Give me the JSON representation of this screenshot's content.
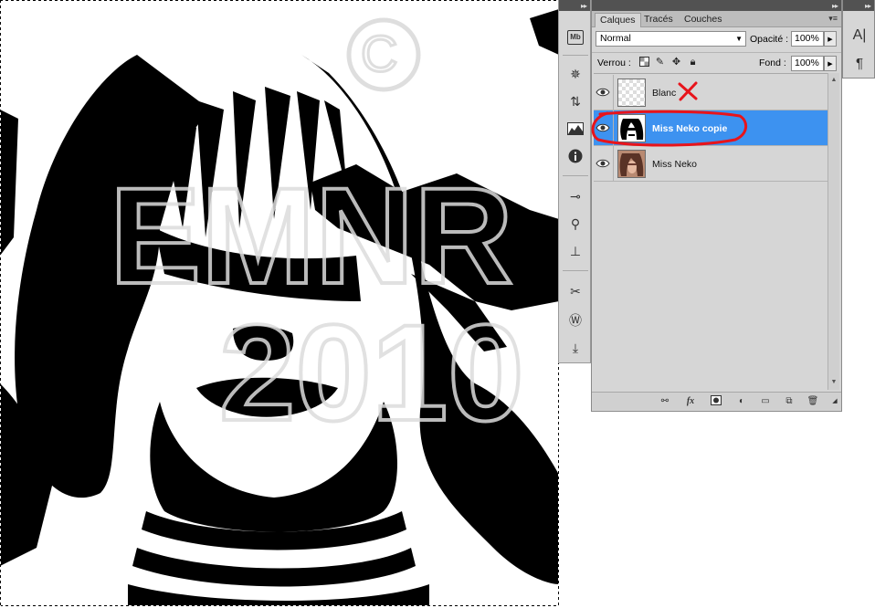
{
  "panel": {
    "tabs": [
      {
        "label": "Calques",
        "active": true
      },
      {
        "label": "Tracés",
        "active": false
      },
      {
        "label": "Couches",
        "active": false
      }
    ],
    "blend_mode": "Normal",
    "opacity_label": "Opacité :",
    "opacity_value": "100%",
    "lock_label": "Verrou :",
    "fill_label": "Fond :",
    "fill_value": "100%"
  },
  "layers": [
    {
      "name": "Blanc",
      "visible": true,
      "selected": false,
      "thumbnail": "transparent-checker"
    },
    {
      "name": "Miss Neko copie",
      "visible": true,
      "selected": true,
      "thumbnail": "bw-portrait"
    },
    {
      "name": "Miss Neko",
      "visible": true,
      "selected": false,
      "thumbnail": "color-portrait"
    }
  ],
  "dock_icons": [
    "mini-bridge-icon",
    "navigator-icon",
    "history-icon",
    "histogram-icon",
    "info-icon",
    "brush-presets-icon",
    "clone-source-icon",
    "tool-presets-icon",
    "actions-icon",
    "wiki-icon",
    "notes-icon"
  ],
  "mini_panel": {
    "character_glyph": "A|",
    "paragraph_glyph": "¶"
  },
  "dock_labels": {
    "mini_bridge": "Mb"
  },
  "colors": {
    "selection": "#3d92f0",
    "panel_bg": "#d6d6d6",
    "annotation_red": "#e8141b"
  },
  "watermark": "© EMNR 2010"
}
